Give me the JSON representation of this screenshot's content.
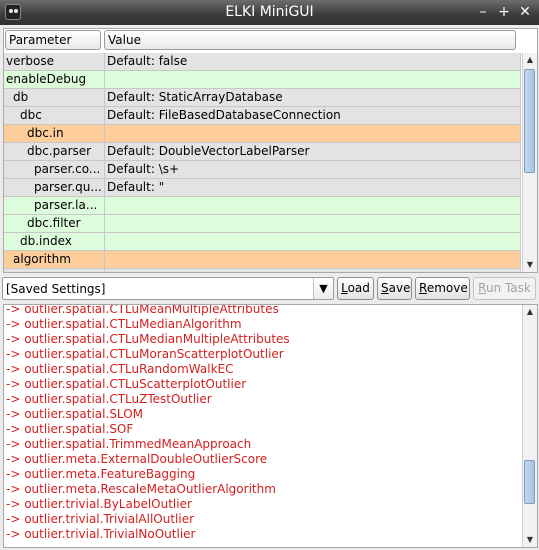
{
  "window": {
    "title": "ELKI MiniGUI",
    "controls": {
      "minimize": "–",
      "maximize": "+",
      "close": "✕"
    }
  },
  "table": {
    "headers": {
      "parameter": "Parameter",
      "value": "Value"
    },
    "rows": [
      {
        "name": "verbose",
        "value": "Default: false",
        "indent": 0,
        "color": "grey"
      },
      {
        "name": "enableDebug",
        "value": "",
        "indent": 0,
        "color": "green"
      },
      {
        "name": "db",
        "value": "Default: StaticArrayDatabase",
        "indent": 1,
        "color": "grey"
      },
      {
        "name": "dbc",
        "value": "Default: FileBasedDatabaseConnection",
        "indent": 2,
        "color": "grey"
      },
      {
        "name": "dbc.in",
        "value": "",
        "indent": 3,
        "color": "orange"
      },
      {
        "name": "dbc.parser",
        "value": "Default: DoubleVectorLabelParser",
        "indent": 3,
        "color": "grey"
      },
      {
        "name": "parser.co...",
        "value": "Default: \\s+",
        "indent": 4,
        "color": "grey"
      },
      {
        "name": "parser.qu...",
        "value": "Default: \"",
        "indent": 4,
        "color": "grey"
      },
      {
        "name": "parser.la...",
        "value": "",
        "indent": 4,
        "color": "green"
      },
      {
        "name": "dbc.filter",
        "value": "",
        "indent": 3,
        "color": "green"
      },
      {
        "name": "db.index",
        "value": "",
        "indent": 2,
        "color": "green"
      },
      {
        "name": "algorithm",
        "value": "",
        "indent": 1,
        "color": "orange"
      },
      {
        "name": "",
        "value": "",
        "indent": 0,
        "color": "grey"
      }
    ]
  },
  "toolbar": {
    "saved_settings": "[Saved Settings]",
    "load_label": {
      "accel": "L",
      "rest": "oad"
    },
    "save_label": {
      "accel": "S",
      "rest": "ave"
    },
    "remove_label": {
      "accel": "R",
      "rest": "emove"
    },
    "run_label": {
      "accel": "R",
      "rest": "un Task"
    }
  },
  "log": {
    "text_color": "#d41f1f",
    "lines": [
      "-> outlier.spatial.CTLuMeanMultipleAttributes",
      "-> outlier.spatial.CTLuMedianAlgorithm",
      "-> outlier.spatial.CTLuMedianMultipleAttributes",
      "-> outlier.spatial.CTLuMoranScatterplotOutlier",
      "-> outlier.spatial.CTLuRandomWalkEC",
      "-> outlier.spatial.CTLuScatterplotOutlier",
      "-> outlier.spatial.CTLuZTestOutlier",
      "-> outlier.spatial.SLOM",
      "-> outlier.spatial.SOF",
      "-> outlier.spatial.TrimmedMeanApproach",
      "-> outlier.meta.ExternalDoubleOutlierScore",
      "-> outlier.meta.FeatureBagging",
      "-> outlier.meta.RescaleMetaOutlierAlgorithm",
      "-> outlier.trivial.ByLabelOutlier",
      "-> outlier.trivial.TrivialAllOutlier",
      "-> outlier.trivial.TrivialNoOutlier"
    ]
  },
  "colors": {
    "row_default": "#e3e3e3",
    "row_optional": "#ddfcdc",
    "row_required": "#fdcd9b",
    "log_text": "#d41f1f"
  }
}
